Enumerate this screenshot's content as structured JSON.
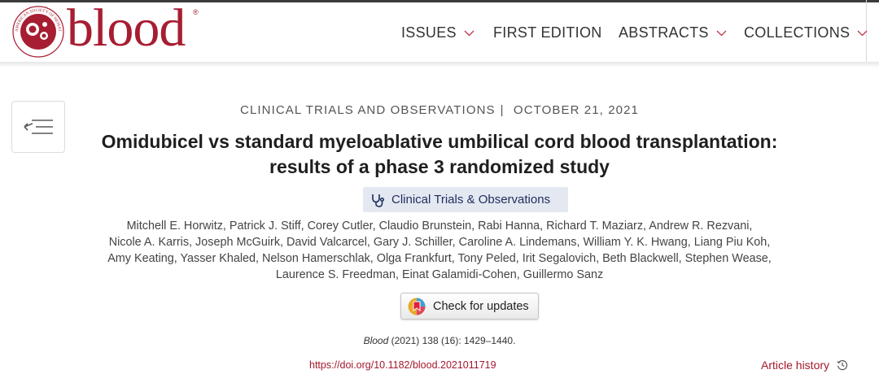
{
  "header": {
    "logo": {
      "wordmark": "blood",
      "seal_text": "AMERICAN SOCIETY OF HEMATOLOGY",
      "registered_mark": "®",
      "color": "#a71d31"
    },
    "nav": [
      {
        "label": "ISSUES",
        "has_dropdown": true
      },
      {
        "label": "FIRST EDITION",
        "has_dropdown": false
      },
      {
        "label": "ABSTRACTS",
        "has_dropdown": true
      },
      {
        "label": "COLLECTIONS",
        "has_dropdown": true
      }
    ]
  },
  "toc_button": {
    "icon": "table-of-contents-icon"
  },
  "article": {
    "category": "CLINICAL TRIALS AND OBSERVATIONS",
    "separator": "|",
    "date": "OCTOBER 21, 2021",
    "title_line1": "Omidubicel vs standard myeloablative umbilical cord blood transplantation:",
    "title_line2": "results of a phase 3 randomized study",
    "topic_badge": {
      "label": "Clinical Trials & Observations",
      "icon": "stethoscope-icon",
      "color": "#e4e8f1"
    },
    "authors": [
      "Mitchell E. Horwitz, Patrick J. Stiff, Corey Cutler, Claudio Brunstein, Rabi Hanna, Richard T. Maziarz, Andrew R. Rezvani,",
      "Nicole A. Karris, Joseph McGuirk, David Valcarcel, Gary J. Schiller, Caroline A. Lindemans, William Y. K. Hwang, Liang Piu Koh,",
      "Amy Keating, Yasser Khaled, Nelson Hamerschlak, Olga Frankfurt, Tony Peled, Irit Segalovich, Beth Blackwell, Stephen Wease,",
      "Laurence S. Freedman, Einat Galamidi-Cohen, Guillermo Sanz"
    ],
    "check_updates": {
      "label": "Check for updates",
      "icon": "crossmark-icon"
    },
    "citation": {
      "journal": "Blood",
      "details": " (2021) 138 (16): 1429–1440."
    },
    "doi": "https://doi.org/10.1182/blood.2021011719",
    "history_link": {
      "label": "Article history",
      "icon": "history-icon"
    },
    "accent_color": "#a3182c"
  }
}
